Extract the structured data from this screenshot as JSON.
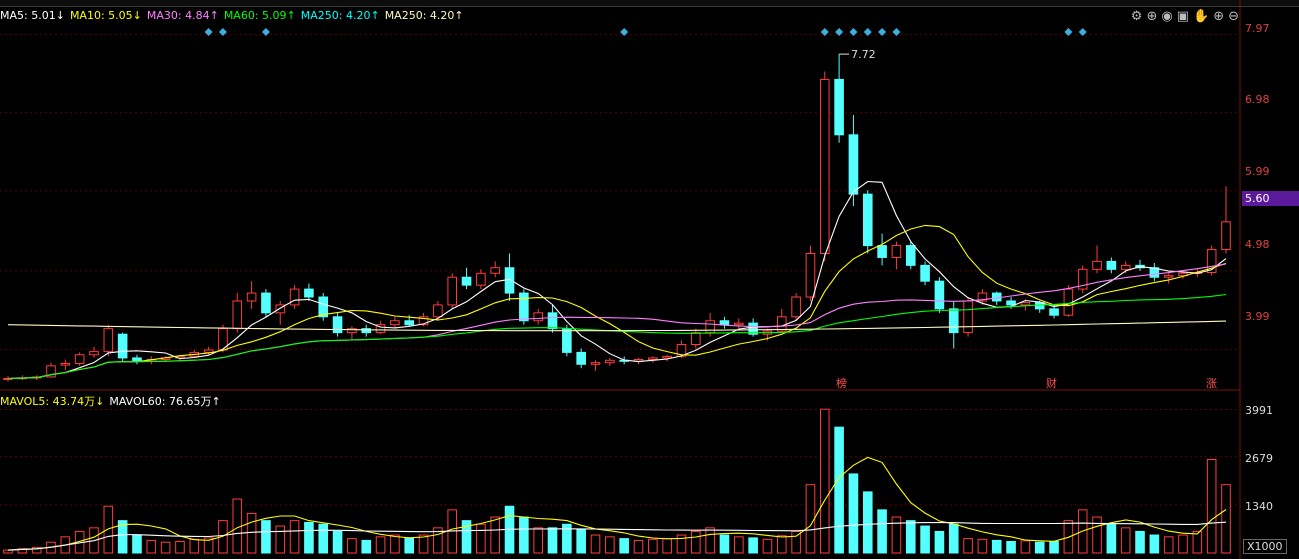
{
  "toolbar_icons": [
    "gear-icon",
    "zoom-icon",
    "eye-icon",
    "basket-icon",
    "hand-icon",
    "plus-icon",
    "minus-icon"
  ],
  "price_axis": {
    "ticks": [
      "7.97",
      "6.98",
      "5.99",
      "4.98",
      "3.99"
    ],
    "current_price": "5.60"
  },
  "volume_axis": {
    "ticks": [
      "3991",
      "2679",
      "1340"
    ],
    "unit": "X1000"
  },
  "event_markers": [
    "榜",
    "财",
    "涨"
  ],
  "peak_label": "7.72",
  "ma_legend": [
    {
      "label": "MA5: 5.01↓",
      "color": "#ffffff"
    },
    {
      "label": "MA10: 5.05↓",
      "color": "#ffff00"
    },
    {
      "label": "MA30: 4.84↑",
      "color": "#ff80ff"
    },
    {
      "label": "MA60: 5.09↑",
      "color": "#00ff00"
    },
    {
      "label": "MA250: 4.20↑",
      "color": "#00ffff"
    },
    {
      "label": "MA250: 4.20↑",
      "color": "#fff8c0"
    }
  ],
  "vol_legend": [
    {
      "label": "MAVOL5: 43.74万↓",
      "color": "#ffff00"
    },
    {
      "label": "MAVOL60: 76.65万↑",
      "color": "#ffffff"
    }
  ],
  "chart_data": [
    {
      "type": "candlestick",
      "y_ticks": [
        7.97,
        6.98,
        5.99,
        4.98,
        3.99
      ],
      "ylim": [
        3.5,
        8.05
      ],
      "ohlc": [
        [
          3.61,
          3.65,
          3.58,
          3.62
        ],
        [
          3.62,
          3.66,
          3.6,
          3.63
        ],
        [
          3.63,
          3.66,
          3.6,
          3.64
        ],
        [
          3.64,
          3.82,
          3.63,
          3.78
        ],
        [
          3.79,
          3.86,
          3.73,
          3.81
        ],
        [
          3.81,
          3.95,
          3.78,
          3.92
        ],
        [
          3.92,
          4.02,
          3.88,
          3.96
        ],
        [
          3.96,
          4.3,
          3.9,
          4.25
        ],
        [
          4.18,
          4.2,
          3.84,
          3.88
        ],
        [
          3.88,
          3.92,
          3.8,
          3.84
        ],
        [
          3.84,
          3.9,
          3.8,
          3.86
        ],
        [
          3.86,
          3.9,
          3.84,
          3.88
        ],
        [
          3.88,
          3.92,
          3.84,
          3.9
        ],
        [
          3.9,
          3.98,
          3.88,
          3.95
        ],
        [
          3.95,
          4.02,
          3.92,
          3.98
        ],
        [
          3.98,
          4.3,
          3.95,
          4.25
        ],
        [
          4.25,
          4.7,
          4.2,
          4.6
        ],
        [
          4.6,
          4.85,
          4.5,
          4.7
        ],
        [
          4.7,
          4.75,
          4.4,
          4.45
        ],
        [
          4.45,
          4.6,
          4.3,
          4.55
        ],
        [
          4.55,
          4.8,
          4.5,
          4.75
        ],
        [
          4.75,
          4.82,
          4.6,
          4.65
        ],
        [
          4.65,
          4.7,
          4.35,
          4.4
        ],
        [
          4.4,
          4.45,
          4.15,
          4.2
        ],
        [
          4.2,
          4.28,
          4.1,
          4.25
        ],
        [
          4.25,
          4.3,
          4.15,
          4.2
        ],
        [
          4.2,
          4.35,
          4.18,
          4.3
        ],
        [
          4.3,
          4.4,
          4.25,
          4.35
        ],
        [
          4.35,
          4.42,
          4.28,
          4.3
        ],
        [
          4.3,
          4.45,
          4.28,
          4.4
        ],
        [
          4.4,
          4.6,
          4.35,
          4.55
        ],
        [
          4.55,
          4.95,
          4.5,
          4.9
        ],
        [
          4.9,
          5.02,
          4.75,
          4.8
        ],
        [
          4.8,
          5.0,
          4.75,
          4.95
        ],
        [
          4.95,
          5.1,
          4.9,
          5.02
        ],
        [
          5.02,
          5.2,
          4.6,
          4.7
        ],
        [
          4.7,
          4.75,
          4.3,
          4.35
        ],
        [
          4.35,
          4.5,
          4.3,
          4.45
        ],
        [
          4.45,
          4.55,
          4.2,
          4.25
        ],
        [
          4.25,
          4.3,
          3.9,
          3.95
        ],
        [
          3.95,
          4.0,
          3.75,
          3.8
        ],
        [
          3.8,
          3.85,
          3.72,
          3.82
        ],
        [
          3.82,
          3.88,
          3.78,
          3.85
        ],
        [
          3.85,
          3.9,
          3.8,
          3.84
        ],
        [
          3.84,
          3.88,
          3.8,
          3.86
        ],
        [
          3.86,
          3.9,
          3.82,
          3.88
        ],
        [
          3.88,
          3.92,
          3.84,
          3.9
        ],
        [
          3.9,
          4.1,
          3.88,
          4.05
        ],
        [
          4.05,
          4.25,
          4.0,
          4.2
        ],
        [
          4.2,
          4.45,
          4.15,
          4.35
        ],
        [
          4.35,
          4.4,
          4.25,
          4.3
        ],
        [
          4.3,
          4.38,
          4.25,
          4.32
        ],
        [
          4.32,
          4.38,
          4.15,
          4.18
        ],
        [
          4.18,
          4.25,
          4.1,
          4.22
        ],
        [
          4.22,
          4.5,
          4.2,
          4.4
        ],
        [
          4.4,
          4.7,
          4.35,
          4.65
        ],
        [
          4.65,
          5.3,
          4.6,
          5.2
        ],
        [
          5.2,
          7.5,
          5.1,
          7.4
        ],
        [
          7.4,
          7.72,
          6.6,
          6.7
        ],
        [
          6.7,
          6.95,
          5.8,
          5.95
        ],
        [
          5.95,
          6.0,
          5.2,
          5.3
        ],
        [
          5.3,
          5.45,
          5.05,
          5.15
        ],
        [
          5.15,
          5.35,
          5.0,
          5.3
        ],
        [
          5.3,
          5.35,
          5.0,
          5.05
        ],
        [
          5.05,
          5.1,
          4.8,
          4.85
        ],
        [
          4.85,
          4.9,
          4.45,
          4.5
        ],
        [
          4.5,
          4.6,
          4.0,
          4.2
        ],
        [
          4.2,
          4.65,
          4.15,
          4.6
        ],
        [
          4.6,
          4.75,
          4.55,
          4.7
        ],
        [
          4.7,
          4.72,
          4.55,
          4.6
        ],
        [
          4.6,
          4.65,
          4.5,
          4.55
        ],
        [
          4.55,
          4.62,
          4.48,
          4.58
        ],
        [
          4.58,
          4.6,
          4.45,
          4.5
        ],
        [
          4.5,
          4.55,
          4.38,
          4.42
        ],
        [
          4.42,
          4.8,
          4.4,
          4.75
        ],
        [
          4.75,
          5.05,
          4.7,
          5.0
        ],
        [
          5.0,
          5.3,
          4.95,
          5.1
        ],
        [
          5.1,
          5.15,
          4.95,
          5.0
        ],
        [
          5.0,
          5.1,
          4.95,
          5.05
        ],
        [
          5.05,
          5.12,
          4.98,
          5.02
        ],
        [
          5.02,
          5.08,
          4.85,
          4.9
        ],
        [
          4.9,
          4.95,
          4.82,
          4.92
        ],
        [
          4.92,
          4.96,
          4.88,
          4.95
        ],
        [
          4.95,
          5.0,
          4.9,
          4.96
        ],
        [
          4.96,
          5.3,
          4.92,
          5.25
        ],
        [
          5.25,
          6.05,
          5.2,
          5.6
        ]
      ]
    },
    {
      "type": "bar",
      "unit": "X1000",
      "y_ticks": [
        3991,
        2679,
        1340
      ],
      "ylim": [
        0,
        4200
      ],
      "values": [
        80,
        120,
        150,
        300,
        450,
        600,
        700,
        1300,
        900,
        500,
        350,
        300,
        320,
        380,
        420,
        900,
        1500,
        1100,
        900,
        750,
        900,
        850,
        800,
        600,
        400,
        350,
        450,
        500,
        420,
        500,
        700,
        1200,
        900,
        800,
        1000,
        1300,
        1000,
        700,
        700,
        800,
        650,
        500,
        450,
        400,
        350,
        380,
        400,
        500,
        600,
        700,
        500,
        450,
        420,
        380,
        480,
        600,
        1900,
        4000,
        3500,
        2200,
        1700,
        1200,
        1000,
        900,
        750,
        600,
        800,
        400,
        380,
        350,
        320,
        340,
        300,
        320,
        900,
        1200,
        1000,
        800,
        700,
        600,
        500,
        450,
        500,
        600,
        2600,
        1900
      ]
    }
  ]
}
